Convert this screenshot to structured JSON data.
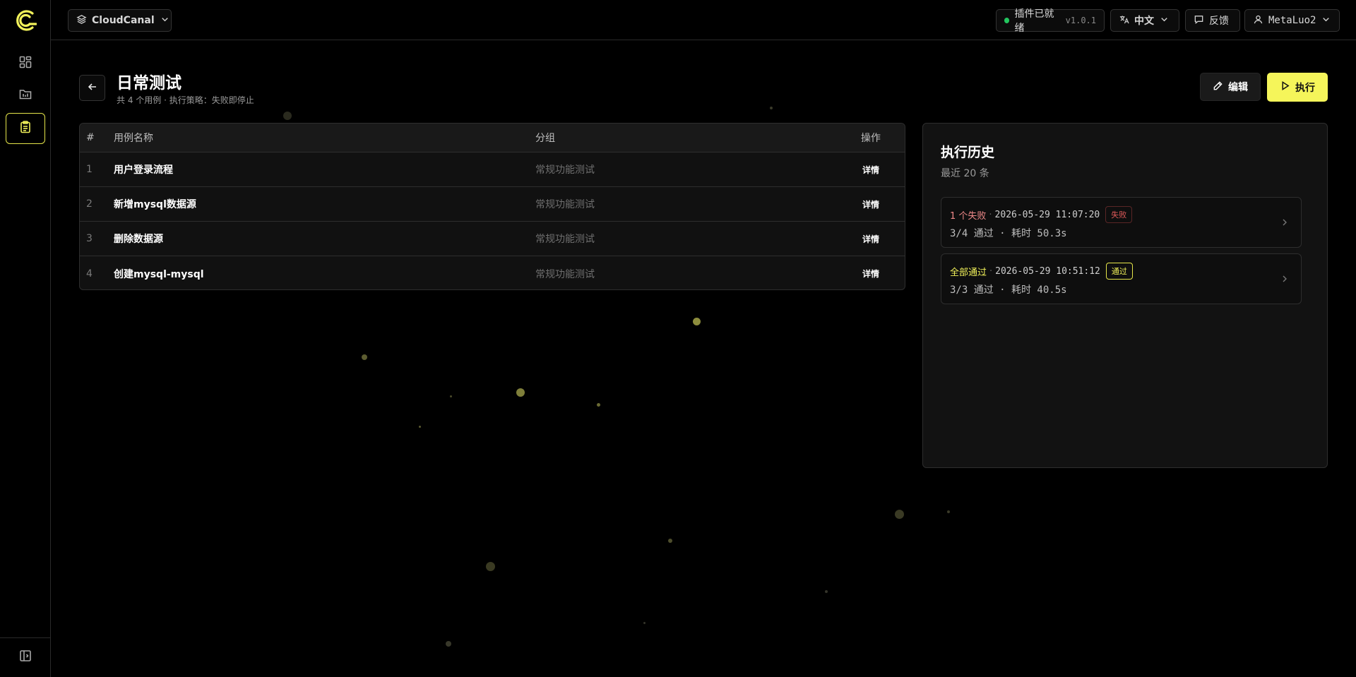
{
  "brand": {
    "workspace_label": "CloudCanal"
  },
  "topbar": {
    "plugin_status": "插件已就绪",
    "plugin_version": "v1.0.1",
    "language": "中文",
    "feedback": "反馈",
    "user": "MetaLuo2"
  },
  "page": {
    "title": "日常测试",
    "subtitle": "共 4 个用例 · 执行策略：失败即停止",
    "edit_label": "编辑",
    "run_label": "执行"
  },
  "table": {
    "headers": {
      "num": "#",
      "name": "用例名称",
      "group": "分组",
      "op": "操作"
    },
    "rows": [
      {
        "num": "1",
        "name": "用户登录流程",
        "group": "常规功能测试",
        "op": "详情"
      },
      {
        "num": "2",
        "name": "新增mysql数据源",
        "group": "常规功能测试",
        "op": "详情"
      },
      {
        "num": "3",
        "name": "删除数据源",
        "group": "常规功能测试",
        "op": "详情"
      },
      {
        "num": "4",
        "name": "创建mysql-mysql",
        "group": "常规功能测试",
        "op": "详情"
      }
    ]
  },
  "history": {
    "title": "执行历史",
    "subtitle": "最近 20 条",
    "items": [
      {
        "status": "1 个失败",
        "time": "2026-05-29 11:07:20",
        "badge": "失败",
        "summary": "3/4 通过 · 耗时 50.3s"
      },
      {
        "status": "全部通过",
        "time": "2026-05-29 10:51:12",
        "badge": "通过",
        "summary": "3/3 通过 · 耗时 40.5s"
      }
    ]
  },
  "colors": {
    "accent": "#f5f55a",
    "fail": "#e05a5a",
    "status_ok": "#22c55e"
  },
  "icons": {
    "logo": "cloudcanal-logo-icon",
    "nav": [
      "dashboard-icon",
      "datasource-folder-icon",
      "clipboard-icon"
    ],
    "collapse": "sidebar-collapse-icon"
  }
}
